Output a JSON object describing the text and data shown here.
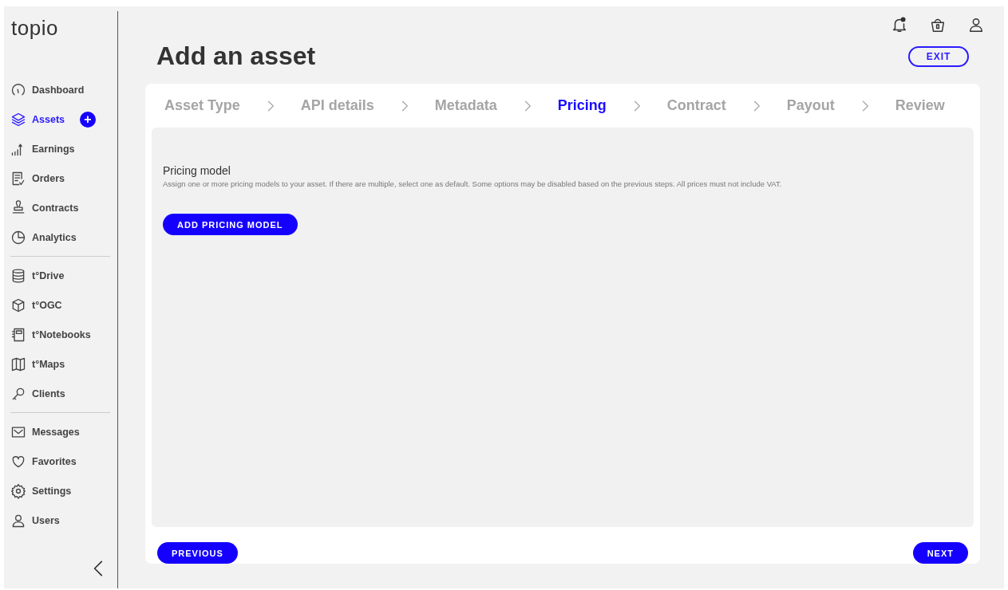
{
  "logo": "topio",
  "sidebar": {
    "groups": [
      {
        "items": [
          {
            "label": "Dashboard",
            "selected": false
          },
          {
            "label": "Assets",
            "selected": true,
            "badge": "+"
          },
          {
            "label": "Earnings",
            "selected": false
          },
          {
            "label": "Orders",
            "selected": false
          },
          {
            "label": "Contracts",
            "selected": false
          },
          {
            "label": "Analytics",
            "selected": false
          }
        ]
      },
      {
        "items": [
          {
            "label": "t°Drive",
            "selected": false
          },
          {
            "label": "t°OGC",
            "selected": false
          },
          {
            "label": "t°Notebooks",
            "selected": false
          },
          {
            "label": "t°Maps",
            "selected": false
          },
          {
            "label": "Clients",
            "selected": false
          }
        ]
      },
      {
        "items": [
          {
            "label": "Messages",
            "selected": false
          },
          {
            "label": "Favorites",
            "selected": false
          },
          {
            "label": "Settings",
            "selected": false
          },
          {
            "label": "Users",
            "selected": false
          }
        ]
      }
    ]
  },
  "page": {
    "title": "Add an asset",
    "exit_button": "EXIT"
  },
  "steps": [
    {
      "label": "Asset Type",
      "selected": false
    },
    {
      "label": "API details",
      "selected": false
    },
    {
      "label": "Metadata",
      "selected": false
    },
    {
      "label": "Pricing",
      "selected": true
    },
    {
      "label": "Contract",
      "selected": false
    },
    {
      "label": "Payout",
      "selected": false
    },
    {
      "label": "Review",
      "selected": false
    }
  ],
  "section": {
    "title": "Pricing model",
    "description": "Assign one or more pricing models to your asset. If there are multiple, select one as default. Some options may be disabled based on the previous steps. All prices must not include VAT.",
    "button": "ADD PRICING MODEL"
  },
  "footer": {
    "previous": "PREVIOUS",
    "next": "NEXT"
  }
}
